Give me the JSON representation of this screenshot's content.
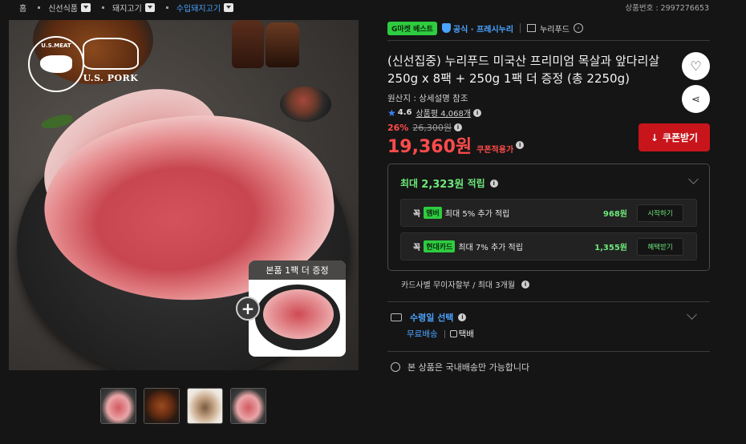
{
  "breadcrumb": {
    "home": "홈",
    "items": [
      "신선식품",
      "돼지고기",
      "수입돼지고기"
    ]
  },
  "product_number": "상품번호 : 2997276653",
  "image": {
    "logo_meat": "U.S.MEAT",
    "logo_pork": "U.S. PORK",
    "bonus_label": "본품 1팩 더 증정"
  },
  "badges": {
    "gmarket_best": "G마켓 베스트",
    "official": "공식 · 프레시누리",
    "store": "누리푸드"
  },
  "product": {
    "title": "(신선집중) 누리푸드 미국산 프리미엄 목살과 앞다리살 250g x 8팩 + 250g 1팩 더 증정 (총 2250g)",
    "origin": "원산지 : 상세설명 참조",
    "rating": "4.6",
    "review_label": "상품평 4,068개",
    "discount": "26%",
    "original_price": "26,300원",
    "price": "19,360원",
    "price_note": "쿠폰적용가",
    "coupon_button": "쿠폰받기"
  },
  "reward": {
    "head_prefix": "최대",
    "head_amount": "2,323원",
    "head_suffix": "적립",
    "rows": [
      {
        "prefix": "꼭",
        "tag": "멤버",
        "text": "최대 5% 추가 적립",
        "amount": "968원",
        "action": "시작하기"
      },
      {
        "prefix": "꼭",
        "tag": "현대카드",
        "text": "최대 7% 추가 적립",
        "amount": "1,355원",
        "action": "혜택받기"
      }
    ]
  },
  "installment": "카드사별 무이자할부 / 최대 3개월",
  "delivery": {
    "label": "수령일 선택",
    "free": "무료배송",
    "courier": "택배"
  },
  "domestic_notice": "본 상품은 국내배송만 가능합니다"
}
